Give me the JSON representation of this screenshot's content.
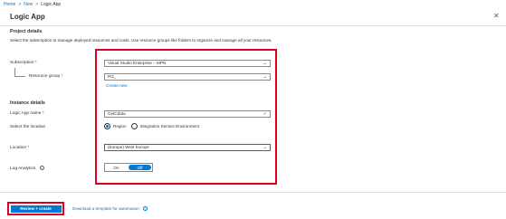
{
  "breadcrumb": {
    "home": "Home",
    "new": "New",
    "current": "Logic App",
    "separator": ">"
  },
  "page": {
    "title": "Logic App",
    "close_glyph": "✕"
  },
  "project": {
    "heading": "Project details",
    "description": "Select the subscription to manage deployed resources and costs. Use resource groups like folders to organize and manage all your resources."
  },
  "subscription": {
    "label": "Subscription",
    "value": "Visual Studio Enterprise – MPN"
  },
  "resource_group": {
    "label": "Resource group",
    "value": "RG_",
    "create_new": "Create new"
  },
  "instance": {
    "heading": "Instance details"
  },
  "app_name": {
    "label": "Logic App name",
    "value": "GetCdata"
  },
  "location_choice": {
    "label": "Select the location",
    "option_region": "Region",
    "option_ise": "Integration Service Environment",
    "selected": "Region"
  },
  "location": {
    "label": "Location",
    "value": "(Europe) West Europe"
  },
  "log_analytics": {
    "label": "Log Analytics",
    "on": "On",
    "off": "Off",
    "selected": "Off",
    "info": "i"
  },
  "required_marker": "*",
  "footer": {
    "review_button": "Review + create",
    "download_link": "Download a template for automation",
    "info": "i"
  },
  "colors": {
    "accent": "#0078d4",
    "highlight": "#e0001b",
    "required": "#a4262c"
  }
}
